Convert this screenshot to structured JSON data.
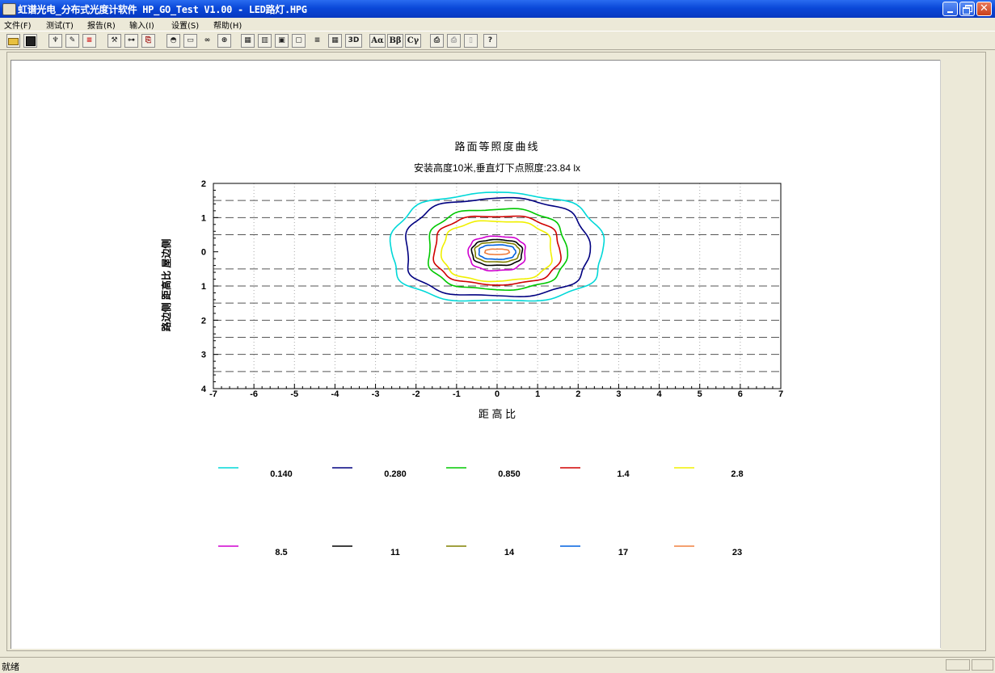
{
  "window": {
    "title": "虹谱光电_分布式光度计软件 HP_GO_Test V1.00 - LED路灯.HPG"
  },
  "menu": [
    "文件(F)",
    "测试(T)",
    "报告(R)",
    "输入(I)",
    "设置(S)",
    "帮助(H)"
  ],
  "toolbar": {
    "icons": [
      "open-icon",
      "save-icon",
      "lamp-icon",
      "measure-icon",
      "report-icon",
      "tools-icon",
      "calibrate-icon",
      "export-icon",
      "dome-icon",
      "flat-icon",
      "chain-icon",
      "globe-icon",
      "grid-a-icon",
      "grid-b-icon",
      "grid-c-icon",
      "grid-d-icon",
      "lines-icon",
      "table-icon",
      "3d-icon",
      "alpha-icon",
      "beta-icon",
      "gamma-icon",
      "print-icon",
      "print-preview-icon",
      "page-icon",
      "help-icon"
    ],
    "labels": {
      "3d": "3D",
      "alpha": "Aα",
      "beta": "Bβ",
      "gamma": "Cγ",
      "help": "?"
    }
  },
  "status": {
    "text": "就绪"
  },
  "chart_data": {
    "type": "contour",
    "title": "路面等照度曲线",
    "subtitle": "安装高度10米,垂直灯下点照度:23.84 lx",
    "xlabel": "距 高 比",
    "ylabel": "路边侧  距高比  屋边侧",
    "xlim": [
      -7,
      7
    ],
    "ylim": [
      -4,
      2
    ],
    "x_ticks": [
      "-7",
      "-6",
      "-5",
      "-4",
      "-3",
      "-2",
      "-1",
      "0",
      "1",
      "2",
      "3",
      "4",
      "5",
      "6",
      "7"
    ],
    "y_ticks": [
      "2",
      "1",
      "0",
      "1",
      "2",
      "3",
      "4"
    ],
    "grid": true,
    "dashed_levels_y": [
      1.5,
      1,
      0.5,
      -0.5,
      -1,
      -1.5,
      -2,
      -2.5,
      -3,
      -3.5
    ],
    "series": [
      {
        "name": "0.140",
        "color": "#00d8d8",
        "rx": 2.6,
        "ry_top": 1.7,
        "ry_bot": 1.45
      },
      {
        "name": "0.280",
        "color": "#000080",
        "rx": 2.25,
        "ry_top": 1.55,
        "ry_bot": 1.3
      },
      {
        "name": "0.850",
        "color": "#00c800",
        "rx": 1.7,
        "ry_top": 1.25,
        "ry_bot": 1.1
      },
      {
        "name": "1.4",
        "color": "#d00000",
        "rx": 1.55,
        "ry_top": 1.05,
        "ry_bot": 0.95
      },
      {
        "name": "2.8",
        "color": "#f0f000",
        "rx": 1.35,
        "ry_top": 0.9,
        "ry_bot": 0.85
      },
      {
        "name": "8.5",
        "color": "#d000d0",
        "rx": 0.7,
        "ry_top": 0.45,
        "ry_bot": 0.55
      },
      {
        "name": "11",
        "color": "#000000",
        "rx": 0.62,
        "ry_top": 0.35,
        "ry_bot": 0.4
      },
      {
        "name": "14",
        "color": "#808000",
        "rx": 0.55,
        "ry_top": 0.28,
        "ry_bot": 0.3
      },
      {
        "name": "17",
        "color": "#0060e0",
        "rx": 0.45,
        "ry_top": 0.2,
        "ry_bot": 0.22
      },
      {
        "name": "23",
        "color": "#f08040",
        "rx": 0.3,
        "ry_top": 0.08,
        "ry_bot": 0.08
      }
    ]
  }
}
